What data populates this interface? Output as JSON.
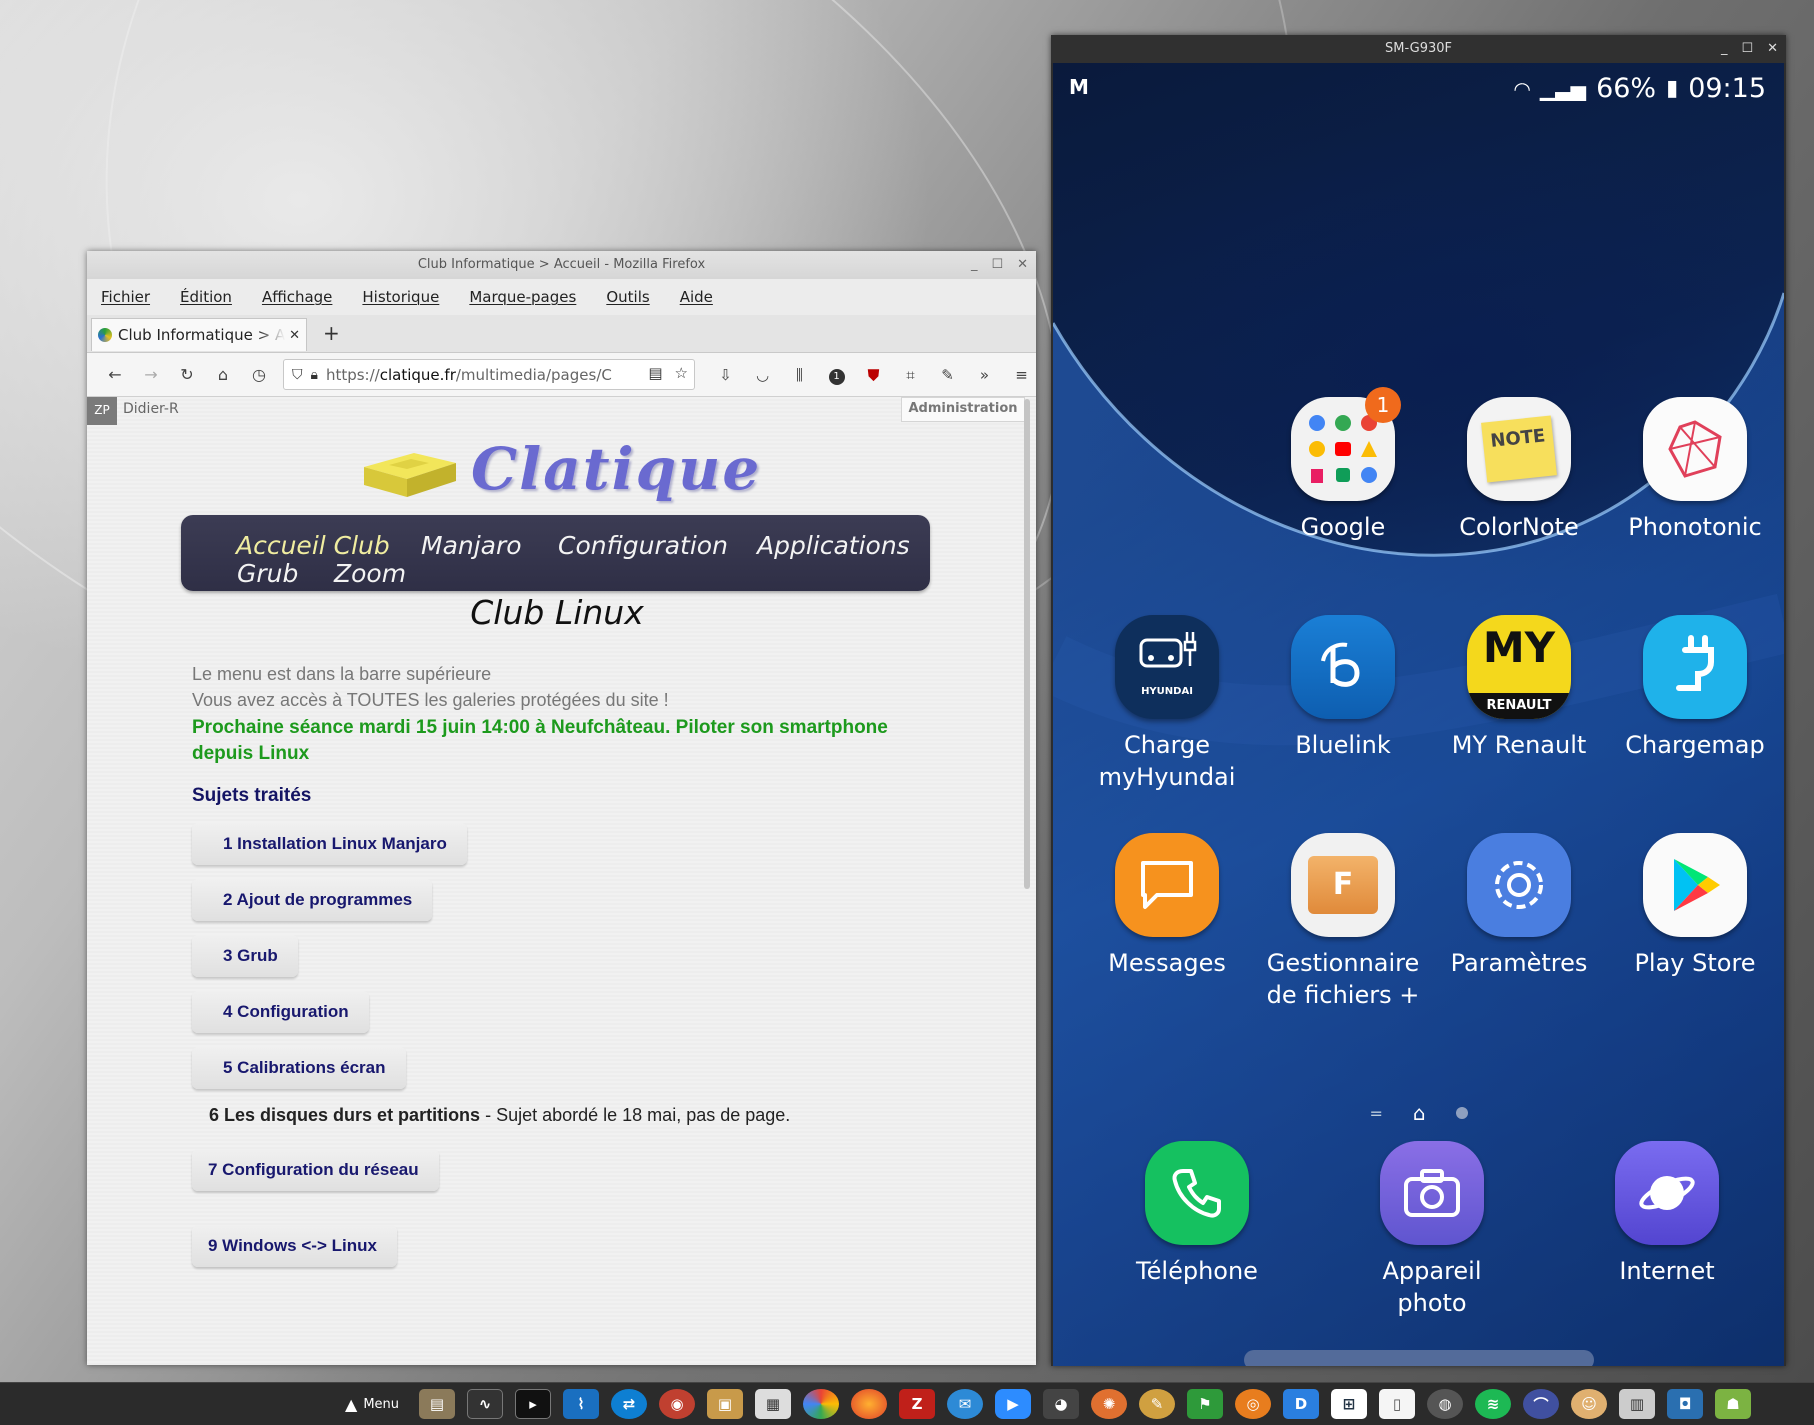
{
  "firefox": {
    "window_title": "Club Informatique > Accueil - Mozilla Firefox",
    "menu": [
      "Fichier",
      "Édition",
      "Affichage",
      "Historique",
      "Marque-pages",
      "Outils",
      "Aide"
    ],
    "tab_title": "Club Informatique > Accueil",
    "new_tab": "+",
    "url_prefix": "https://",
    "url_host": "clatique.fr",
    "url_path": "/multimedia/pages/C",
    "toolbar_badge": "1",
    "page": {
      "zp": "ZP",
      "user": "Didier-R",
      "admin": "Administration",
      "logo": "Clatique",
      "nav": [
        "Accueil Club",
        "Manjaro",
        "Configuration",
        "Applications",
        "Grub",
        "Zoom"
      ],
      "title": "Club Linux",
      "intro_line1": "Le menu est dans la barre supérieure",
      "intro_line2": "Vous avez accès à TOUTES les galeries protégées du site !",
      "notice": "Prochaine séance mardi 15 juin 14:00 à Neufchâteau. Piloter son smartphone depuis Linux",
      "subjects_heading": "Sujets traités",
      "topics": [
        "1 Installation Linux Manjaro",
        "2 Ajout de programmes",
        "3 Grub",
        "4 Configuration",
        "5 Calibrations écran"
      ],
      "topic6_bold": "6 Les disques durs et partitions",
      "topic6_rest": " - Sujet abordé le 18 mai, pas de page.",
      "topic7": "7 Configuration du réseau",
      "topic9": "9 Windows <-> Linux"
    }
  },
  "android": {
    "window_title": "SM-G930F",
    "status": {
      "battery": "66%",
      "time": "09:15"
    },
    "apps": [
      {
        "label": "Google",
        "badge": "1"
      },
      {
        "label": "ColorNote"
      },
      {
        "label": "Phonotonic"
      },
      {
        "label": "Charge myHyundai"
      },
      {
        "label": "Bluelink"
      },
      {
        "label": "MY Renault"
      },
      {
        "label": "Chargemap"
      },
      {
        "label": "Messages"
      },
      {
        "label": "Gestionnaire de fichiers +"
      },
      {
        "label": "Paramètres"
      },
      {
        "label": "Play Store"
      }
    ],
    "dock": [
      "Téléphone",
      "Appareil photo",
      "Internet"
    ],
    "icon_text": {
      "colornote": "NOTE",
      "my": "MY",
      "renault": "RENAULT",
      "hyundai": "HYUNDAI",
      "file": "F"
    }
  },
  "taskbar": {
    "menu_label": "Menu"
  }
}
